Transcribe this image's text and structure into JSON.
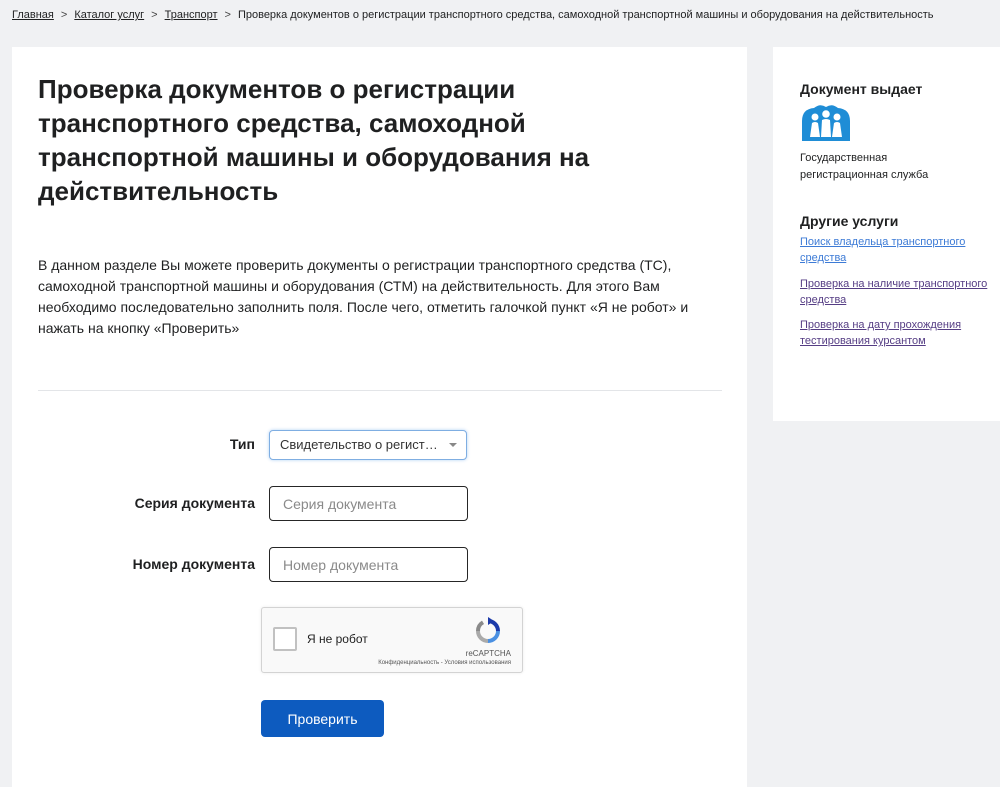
{
  "breadcrumb": {
    "items": [
      "Главная",
      "Каталог услуг",
      "Транспорт"
    ],
    "current": "Проверка документов о регистрации транспортного средства, самоходной транспортной машины и оборудования на действительность",
    "separator": ">"
  },
  "main": {
    "title": "Проверка документов о регистрации транспортного средства, самоходной транспортной машины и оборудования на действительность",
    "intro": "В данном разделе Вы можете проверить документы о регистрации транспортного средства (ТС), самоходной транспортной машины и оборудования (СТМ) на действительность. Для этого Вам необходимо последовательно заполнить поля. После чего, отметить галочкой пункт «Я не робот» и нажать на кнопку «Проверить»"
  },
  "form": {
    "type_label": "Тип",
    "type_value": "Свидетельство о регистрации",
    "series_label": "Серия документа",
    "series_placeholder": "Серия документа",
    "series_value": "",
    "number_label": "Номер документа",
    "number_placeholder": "Номер документа",
    "number_value": "",
    "captcha": {
      "label": "Я не робот",
      "brand": "reCAPTCHA",
      "terms": "Конфиденциальность - Условия использования"
    },
    "submit_label": "Проверить"
  },
  "sidebar": {
    "issuer_heading": "Документ выдает",
    "issuer_name": "Государственная регистрационная служба",
    "other_heading": "Другие услуги",
    "links": [
      "Поиск владельца транспортного средства",
      "Проверка на наличие транспортного средства",
      "Проверка на дату прохождения тестирования курсантом"
    ]
  },
  "colors": {
    "page_bg": "#f0f1f3",
    "primary_button": "#0d5bbf",
    "link_visited": "#553d84",
    "link": "#3d7bd6",
    "issuer_logo": "#1f8dd6"
  },
  "icons": [
    "chevron-down-icon",
    "recaptcha-logo-icon",
    "registration-service-logo"
  ]
}
